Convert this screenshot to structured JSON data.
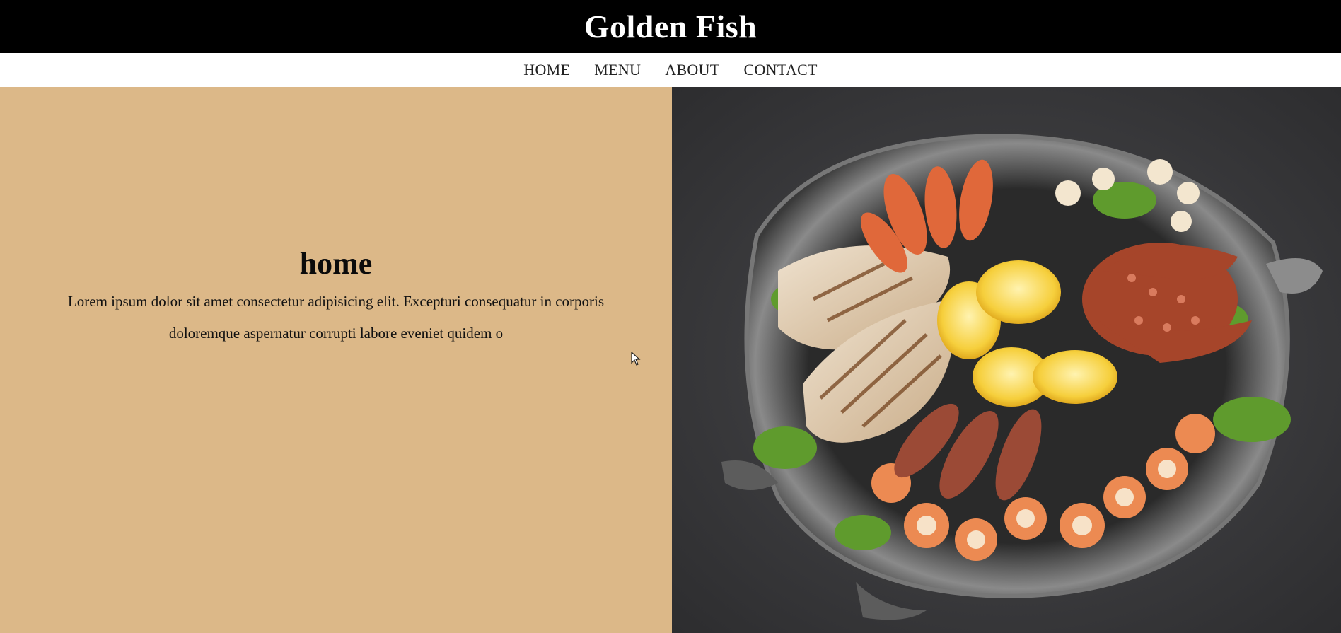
{
  "header": {
    "brand": "Golden Fish"
  },
  "nav": {
    "items": [
      {
        "label": "HOME"
      },
      {
        "label": "MENU"
      },
      {
        "label": "ABOUT"
      },
      {
        "label": "CONTACT"
      }
    ]
  },
  "hero": {
    "heading": "home",
    "body": "Lorem ipsum dolor sit amet consectetur adipisicing elit. Excepturi consequatur in corporis doloremque aspernatur corrupti labore eveniet quidem o",
    "image": {
      "description_icon": "seafood-platter-image"
    }
  },
  "colors": {
    "header_bg": "#000000",
    "hero_left_bg": "#dcb888",
    "hero_right_bg": "#3a3a3c"
  }
}
